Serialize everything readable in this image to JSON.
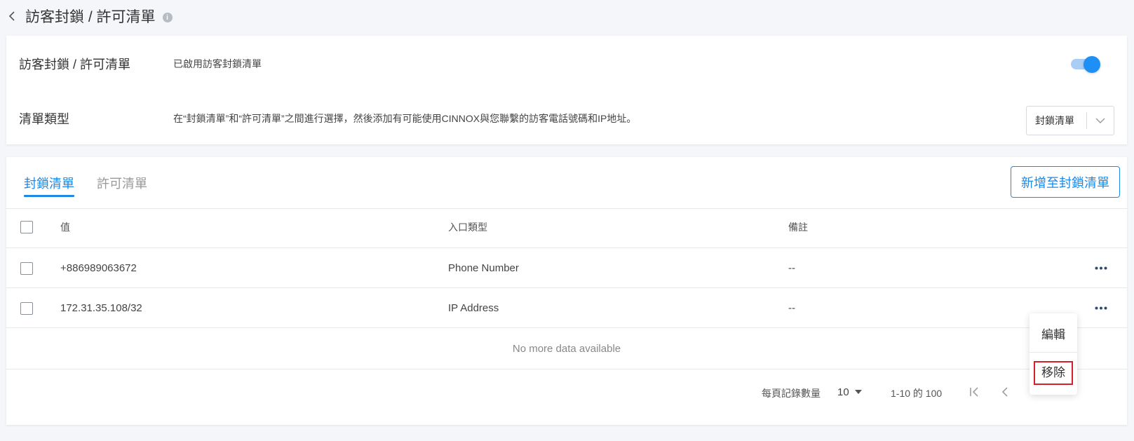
{
  "header": {
    "title": "訪客封鎖 / 許可清單",
    "back_icon": "chevron-left-icon",
    "info_icon": "info-icon"
  },
  "settings": {
    "toggle_row": {
      "label": "訪客封鎖 / 許可清單",
      "description": "已啟用訪客封鎖清單",
      "enabled": true
    },
    "type_row": {
      "label": "清單類型",
      "description": "在“封鎖清單”和“許可清單”之間進行選擇，然後添加有可能使用CINNOX與您聯繫的訪客電話號碼和IP地址。",
      "selected": "封鎖清單"
    }
  },
  "tabs": [
    {
      "label": "封鎖清單",
      "active": true
    },
    {
      "label": "許可清單",
      "active": false
    }
  ],
  "add_button_label": "新增至封鎖清單",
  "table": {
    "columns": [
      "值",
      "入口類型",
      "備註"
    ],
    "rows": [
      {
        "value": "+886989063672",
        "type": "Phone Number",
        "note": "--"
      },
      {
        "value": "172.31.35.108/32",
        "type": "IP Address",
        "note": "--"
      }
    ],
    "empty_text": "No more data available"
  },
  "pagination": {
    "rows_per_page_label": "每頁記錄數量",
    "rows_per_page": "10",
    "range": "1-10 的 100"
  },
  "context_menu": {
    "items": [
      "編輯",
      "移除"
    ],
    "highlighted": "移除"
  },
  "colors": {
    "accent": "#1e88e5",
    "toggle_on": "#1e8ff5",
    "highlight_border": "#d4202a"
  }
}
